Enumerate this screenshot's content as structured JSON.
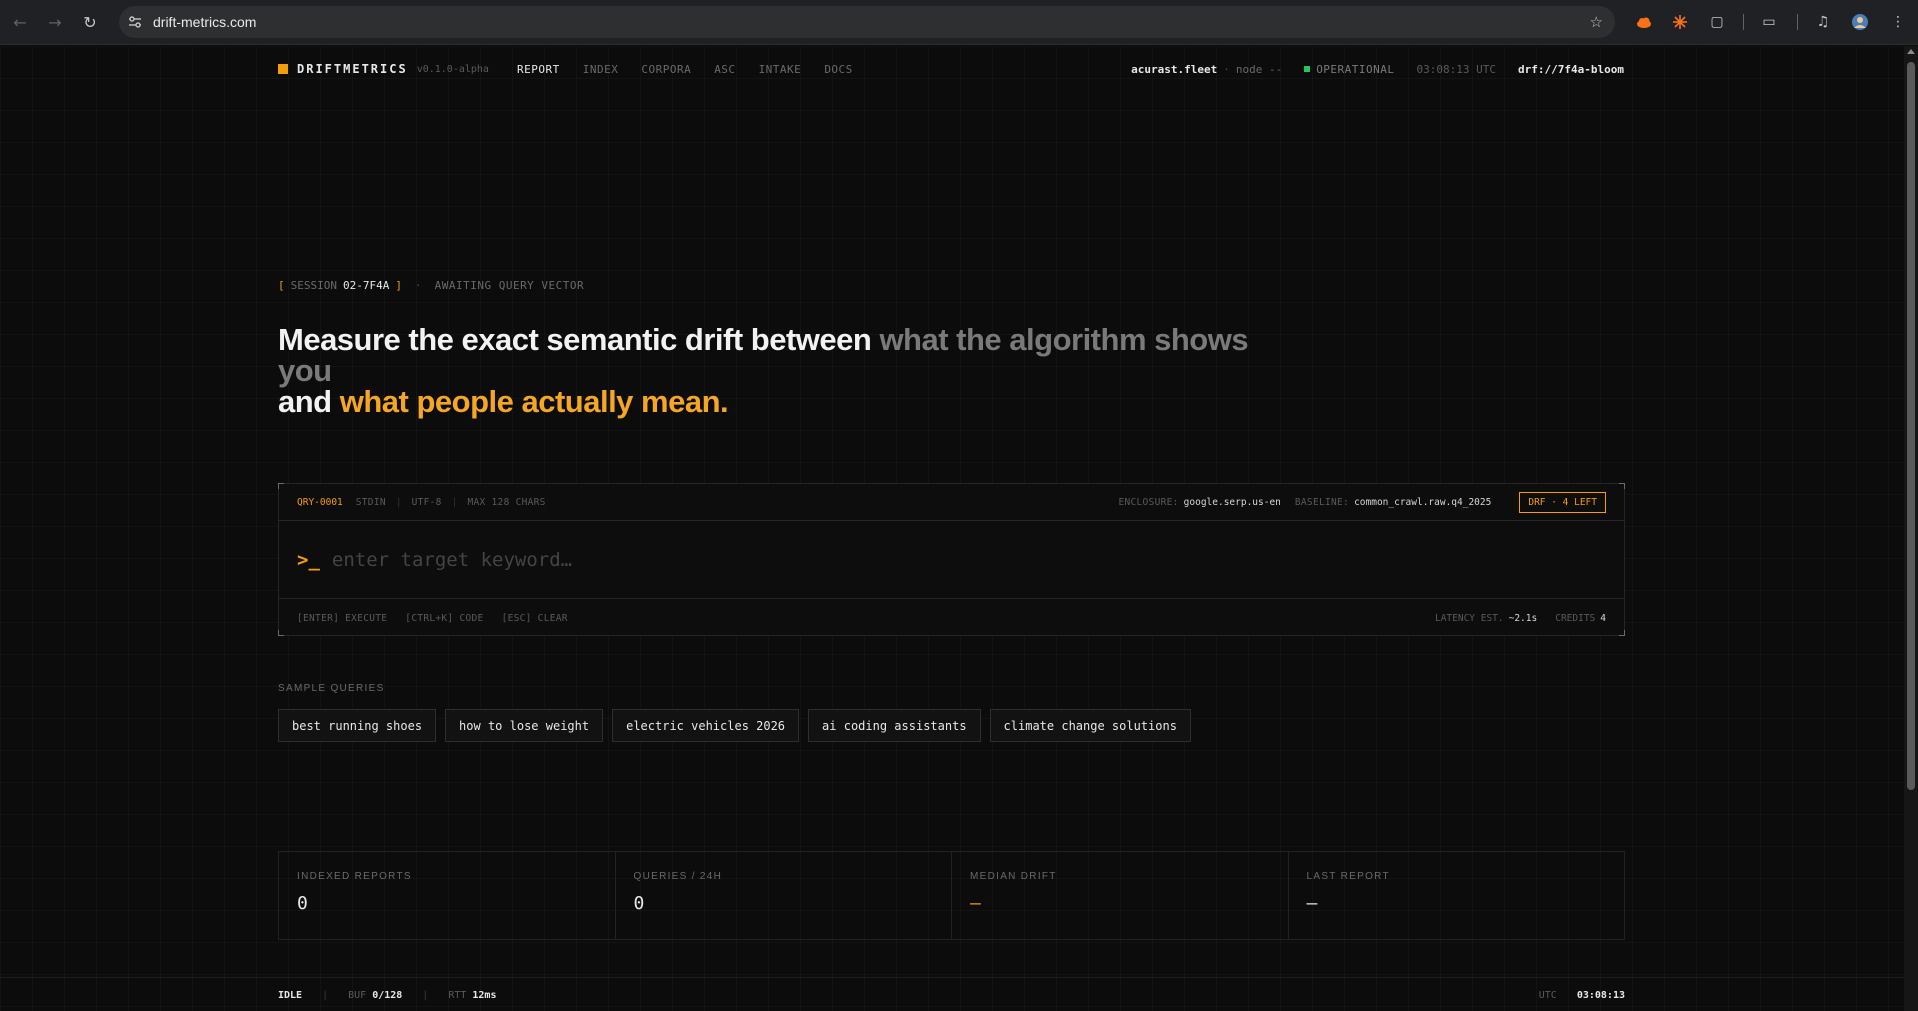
{
  "browser": {
    "url": "drift-metrics.com"
  },
  "nav": {
    "logo_text": "DRIFTMETRICS",
    "version": "v0.1.0-alpha",
    "links": [
      "REPORT",
      "INDEX",
      "CORPORA",
      "ASC",
      "INTAKE",
      "DOCS"
    ],
    "active_link": "REPORT",
    "fleet": "acurast.fleet",
    "node": "node --",
    "status": "OPERATIONAL",
    "status_color": "#22c55e",
    "clock": "03:08:13 UTC",
    "drf_id": "drf://7f4a-bloom"
  },
  "session": {
    "open_bracket": "[",
    "label": "SESSION",
    "id": "02-7F4A",
    "close_bracket": "]",
    "separator": "·",
    "state": "AWAITING QUERY VECTOR"
  },
  "headline": {
    "part1": "Measure the exact semantic drift between ",
    "part2": "what the algorithm shows you",
    "part3": "and ",
    "part4": "what people actually mean."
  },
  "query": {
    "id": "QRY-0001",
    "stdin": "STDIN",
    "encoding": "UTF-8",
    "max": "MAX 128 CHARS",
    "enclosure_label": "ENCLOSURE:",
    "enclosure_value": "google.serp.us-en",
    "baseline_label": "BASELINE:",
    "baseline_value": "common_crawl.raw.q4_2025",
    "badge": "DRF · 4 LEFT",
    "prompt": ">_",
    "input_value": "",
    "placeholder": "enter target keyword…",
    "shortcuts": [
      "[ENTER] EXECUTE",
      "[CTRL+K] CODE",
      "[ESC] CLEAR"
    ],
    "latency_label": "LATENCY EST.",
    "latency_value": "~2.1s",
    "credits_label": "CREDITS",
    "credits_value": "4"
  },
  "samples": {
    "label": "SAMPLE QUERIES",
    "items": [
      "best running shoes",
      "how to lose weight",
      "electric vehicles 2026",
      "ai coding assistants",
      "climate change solutions"
    ]
  },
  "stats": [
    {
      "label": "INDEXED REPORTS",
      "value": "0"
    },
    {
      "label": "QUERIES / 24H",
      "value": "0"
    },
    {
      "label": "MEDIAN DRIFT",
      "value": "—"
    },
    {
      "label": "LAST REPORT",
      "value": "—"
    }
  ],
  "statusbar": {
    "state": "IDLE",
    "buf_label": "BUF",
    "buf_value": "0/128",
    "rtt_label": "RTT",
    "rtt_value": "12ms",
    "utc_label": "UTC",
    "time": "03:08:13"
  },
  "colors": {
    "accent": "#f59e0b",
    "background": "#0c0c0c"
  }
}
